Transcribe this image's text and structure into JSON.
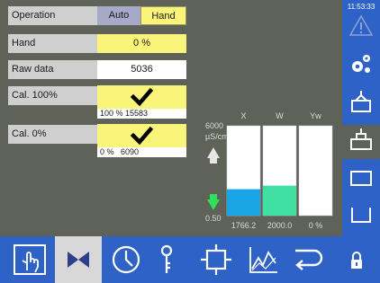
{
  "clock": "11:53:33",
  "rows": {
    "operation": {
      "label": "Operation",
      "option_auto": "Auto",
      "option_hand": "Hand",
      "selected": "Hand"
    },
    "hand": {
      "label": "Hand",
      "value": "0 %"
    },
    "raw_data": {
      "label": "Raw data",
      "value": "5036"
    },
    "cal_100": {
      "label": "Cal. 100%",
      "confirmed": true,
      "info": "100 % 15583"
    },
    "cal_0": {
      "label": "Cal. 0%",
      "confirmed": true,
      "info": "0 %   6090"
    }
  },
  "chart_data": {
    "type": "bar",
    "categories": [
      "X",
      "W",
      "Yw"
    ],
    "values": [
      1766.2,
      2000.0,
      0
    ],
    "value_labels": [
      "1766.2",
      "2000.0",
      "0 %"
    ],
    "ylim": [
      0.5,
      6000
    ],
    "ytick_labels": [
      "6000",
      "0.50"
    ],
    "unit": "µS/cm",
    "bar_colors": [
      "#1aa6e6",
      "#3fe0a2",
      "#ffffff"
    ]
  },
  "sidebar": {
    "buttons": [
      "warning-icon",
      "settings-gears-icon",
      "raise-icon",
      "lift-icon",
      "window-icon",
      "tray-icon"
    ],
    "selected": "lift-icon"
  },
  "bottombar": {
    "buttons": [
      "hand-touch-icon",
      "valve-icon",
      "clock-icon",
      "key-icon",
      "module-icon",
      "chart-icon",
      "back-icon",
      "lock-icon"
    ],
    "selected": "valve-icon"
  },
  "colors": {
    "background": "#5e6258",
    "highlight": "#fbf47a",
    "nav_blue": "#2f62c6",
    "label_grey": "#cfcfcf"
  }
}
